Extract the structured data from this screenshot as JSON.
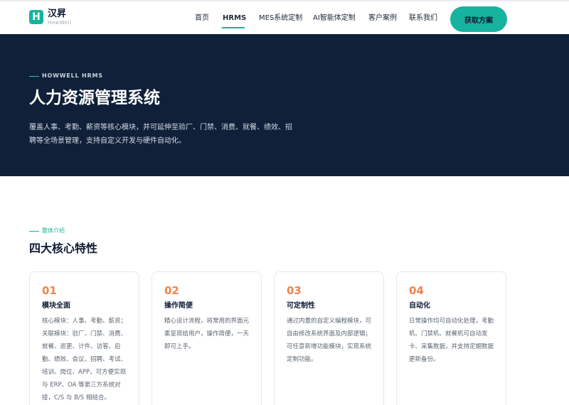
{
  "brand": {
    "name": "汉昇",
    "name_en": "HowWell",
    "logo_letter": "H"
  },
  "nav": {
    "items": [
      {
        "label": "首页"
      },
      {
        "label": "HRMS",
        "active": true
      },
      {
        "label": "MES系统定制"
      },
      {
        "label": "AI智能体定制"
      },
      {
        "label": "客户案例"
      },
      {
        "label": "联系我们"
      }
    ],
    "cta": "获取方案"
  },
  "hero": {
    "tag": "HOWWELL HRMS",
    "title": "人力资源管理系统",
    "description": "覆盖人事、考勤、薪资等核心模块，并可延伸至验厂、门禁、消费、就餐、绩效、招聘等全场景管理，支持自定义开发与硬件自动化。"
  },
  "features": {
    "tag": "整体介绍",
    "title": "四大核心特性",
    "cards": [
      {
        "number": "01",
        "title": "模块全面",
        "description": "核心模块：人事、考勤、薪资；关联模块：验厂、门禁、消费、就餐、巡更、计件、访客、后勤、绩效、会议、招聘、考试、培训、岗位、APP，可方便实现与 ERP、OA 等第三方系统对接，C/S 与 B/S 相结合。"
      },
      {
        "number": "02",
        "title": "操作简便",
        "description": "精心设计流程，将常用的界面元素呈现给用户，操作简便，一天即可上手。"
      },
      {
        "number": "03",
        "title": "可定制性",
        "description": "通过内置的自定义编程模块，可自由修改系统界面及内部逻辑；可任意新增功能模块，实现系统定制功能。"
      },
      {
        "number": "04",
        "title": "自动化",
        "description": "日常操作均可自动化处理，考勤机、门禁机、就餐机可自动发卡、采集数据，并支持定期数据更新备份。"
      }
    ]
  },
  "colors": {
    "accent": "#17b39f",
    "hero_bg": "#102038",
    "number": "#f0844a"
  }
}
